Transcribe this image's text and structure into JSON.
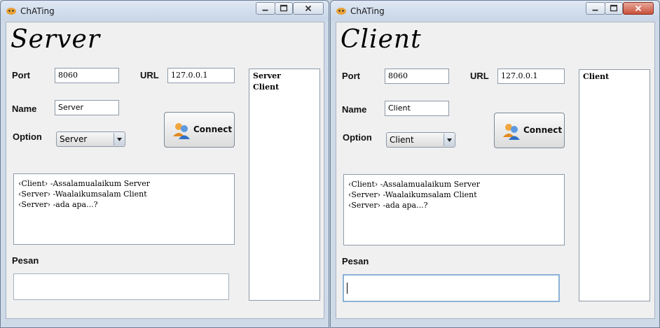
{
  "server_window": {
    "title": "ChATing",
    "heading": "Server",
    "port_label": "Port",
    "port_value": "8060",
    "url_label": "URL",
    "url_value": "127.0.0.1",
    "name_label": "Name",
    "name_value": "Server",
    "option_label": "Option",
    "option_selected": "Server",
    "connect_label": "Connect",
    "messages": [
      "‹Client› -Assalamualaikum Server",
      "‹Server› -Waalaikumsalam Client",
      "‹Server› -ada apa...?"
    ],
    "users": [
      "Server",
      "Client"
    ],
    "pesan_label": "Pesan",
    "pesan_value": ""
  },
  "client_window": {
    "title": "ChATing",
    "heading": "Client",
    "port_label": "Port",
    "port_value": "8060",
    "url_label": "URL",
    "url_value": "127.0.0.1",
    "name_label": "Name",
    "name_value": "Client",
    "option_label": "Option",
    "option_selected": "Client",
    "connect_label": "Connect",
    "messages": [
      "‹Client› -Assalamualaikum Server",
      "‹Server› -Waalaikumsalam Client",
      "‹Server› -ada apa...?"
    ],
    "users": [
      "Client"
    ],
    "pesan_label": "Pesan",
    "pesan_value": ""
  },
  "icons": {
    "app": "cat-app-icon",
    "connect": "users-connect-icon",
    "minimize": "minimize-icon",
    "maximize": "maximize-icon",
    "close": "close-icon",
    "dropdown": "chevron-down-icon"
  },
  "colors": {
    "window_frame": "#cfdae8",
    "content_bg": "#f0f0f0",
    "close_active": "#c8503a",
    "focus_border": "#8db2d8"
  }
}
